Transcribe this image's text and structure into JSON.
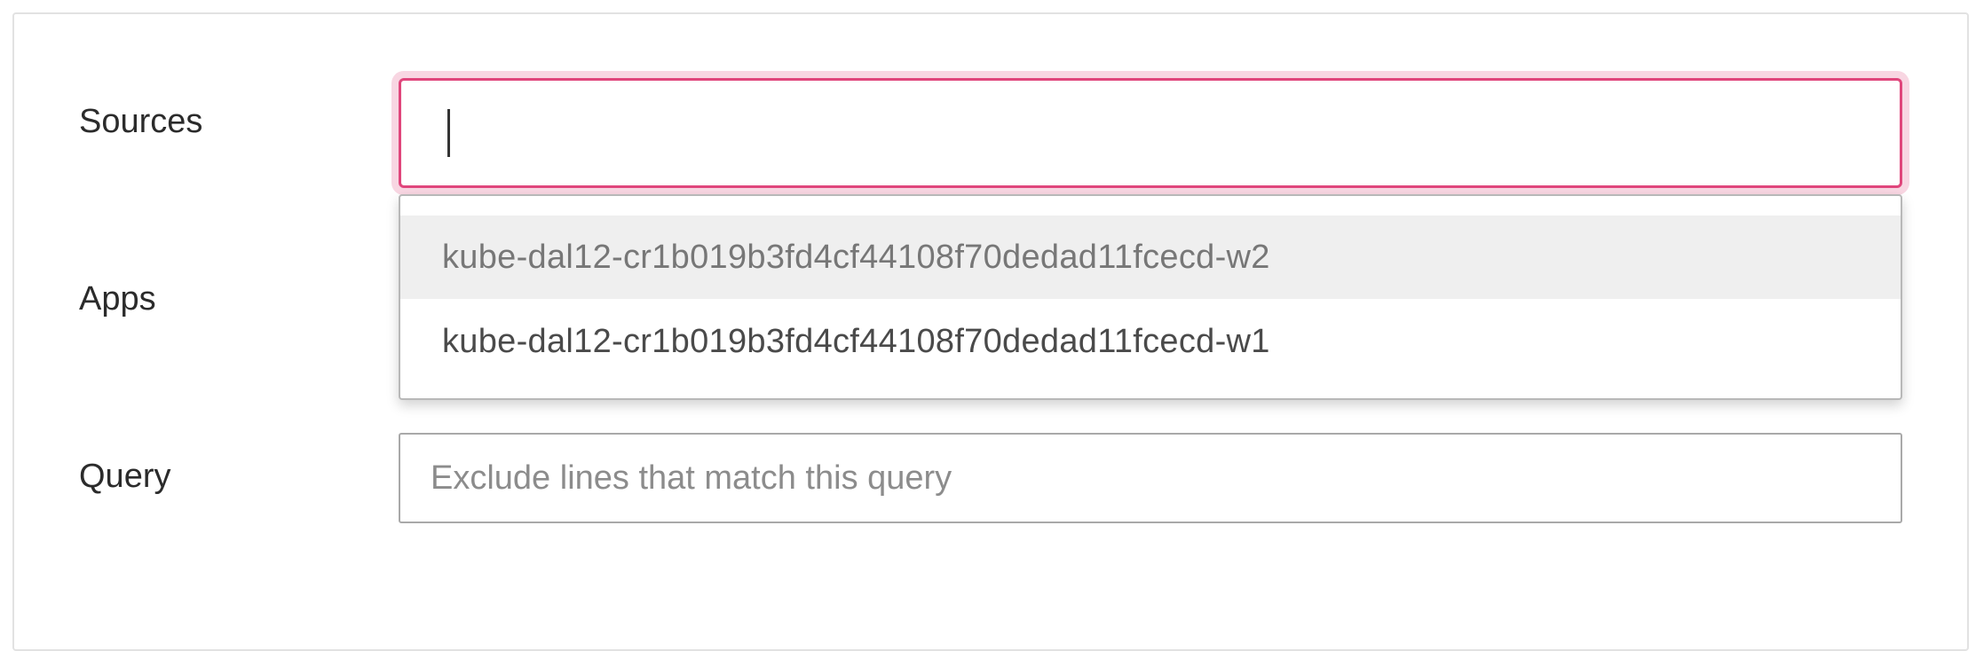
{
  "form": {
    "sources": {
      "label": "Sources",
      "value": ""
    },
    "apps": {
      "label": "Apps"
    },
    "query": {
      "label": "Query",
      "value": "",
      "placeholder": "Exclude lines that match this query"
    }
  },
  "dropdown": {
    "options": [
      {
        "label": "kube-dal12-cr1b019b3fd4cf44108f70dedad11fcecd-w2",
        "highlighted": true
      },
      {
        "label": "kube-dal12-cr1b019b3fd4cf44108f70dedad11fcecd-w1",
        "highlighted": false
      }
    ]
  },
  "colors": {
    "focus_border": "#e0467c",
    "highlight_bg": "#efefef"
  }
}
